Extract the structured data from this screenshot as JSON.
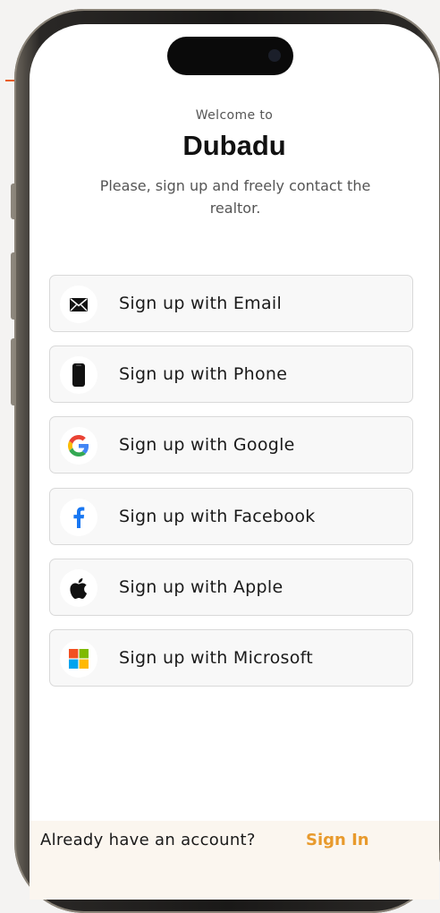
{
  "header": {
    "welcome": "Welcome to",
    "brand": "Dubadu",
    "subtitle": "Please, sign up and freely contact the realtor."
  },
  "signup_options": [
    {
      "label": "Sign up with Email",
      "icon": "envelope-icon"
    },
    {
      "label": "Sign up with Phone",
      "icon": "phone-icon"
    },
    {
      "label": "Sign up with Google",
      "icon": "google-icon"
    },
    {
      "label": "Sign up with Facebook",
      "icon": "facebook-icon"
    },
    {
      "label": "Sign up with Apple",
      "icon": "apple-icon"
    },
    {
      "label": "Sign up with Microsoft",
      "icon": "microsoft-icon"
    }
  ],
  "footer": {
    "prompt": "Already have an account?",
    "signin_label": "Sign In"
  },
  "colors": {
    "accent": "#e89a2c",
    "button_bg": "#f8f8f8",
    "footer_bg": "#fbf6ef",
    "facebook": "#1877f2"
  }
}
